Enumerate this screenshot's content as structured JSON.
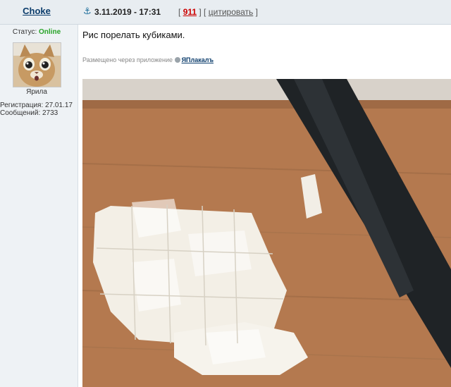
{
  "post": {
    "username": "Choke",
    "date": "3.11.2019 - 17:31",
    "bracket_open": "[",
    "number": "911",
    "bracket_sep": "] [",
    "quote_label": "цитировать",
    "bracket_close": "]",
    "text": "Рис порелать кубиками.",
    "app_note_prefix": "Размещено через приложение",
    "app_name": "ЯПлакалъ"
  },
  "user": {
    "status_label": "Статус:",
    "status_value": "Online",
    "rank": "Ярила",
    "registration": "Регистрация: 27.01.17",
    "messages": "Сообщений: 2733"
  },
  "colors": {
    "online": "#27a327",
    "post_number": "#cc0000",
    "link": "#0b3c6b"
  },
  "icons": {
    "anchor": "anchor-icon",
    "app": "app-icon"
  }
}
